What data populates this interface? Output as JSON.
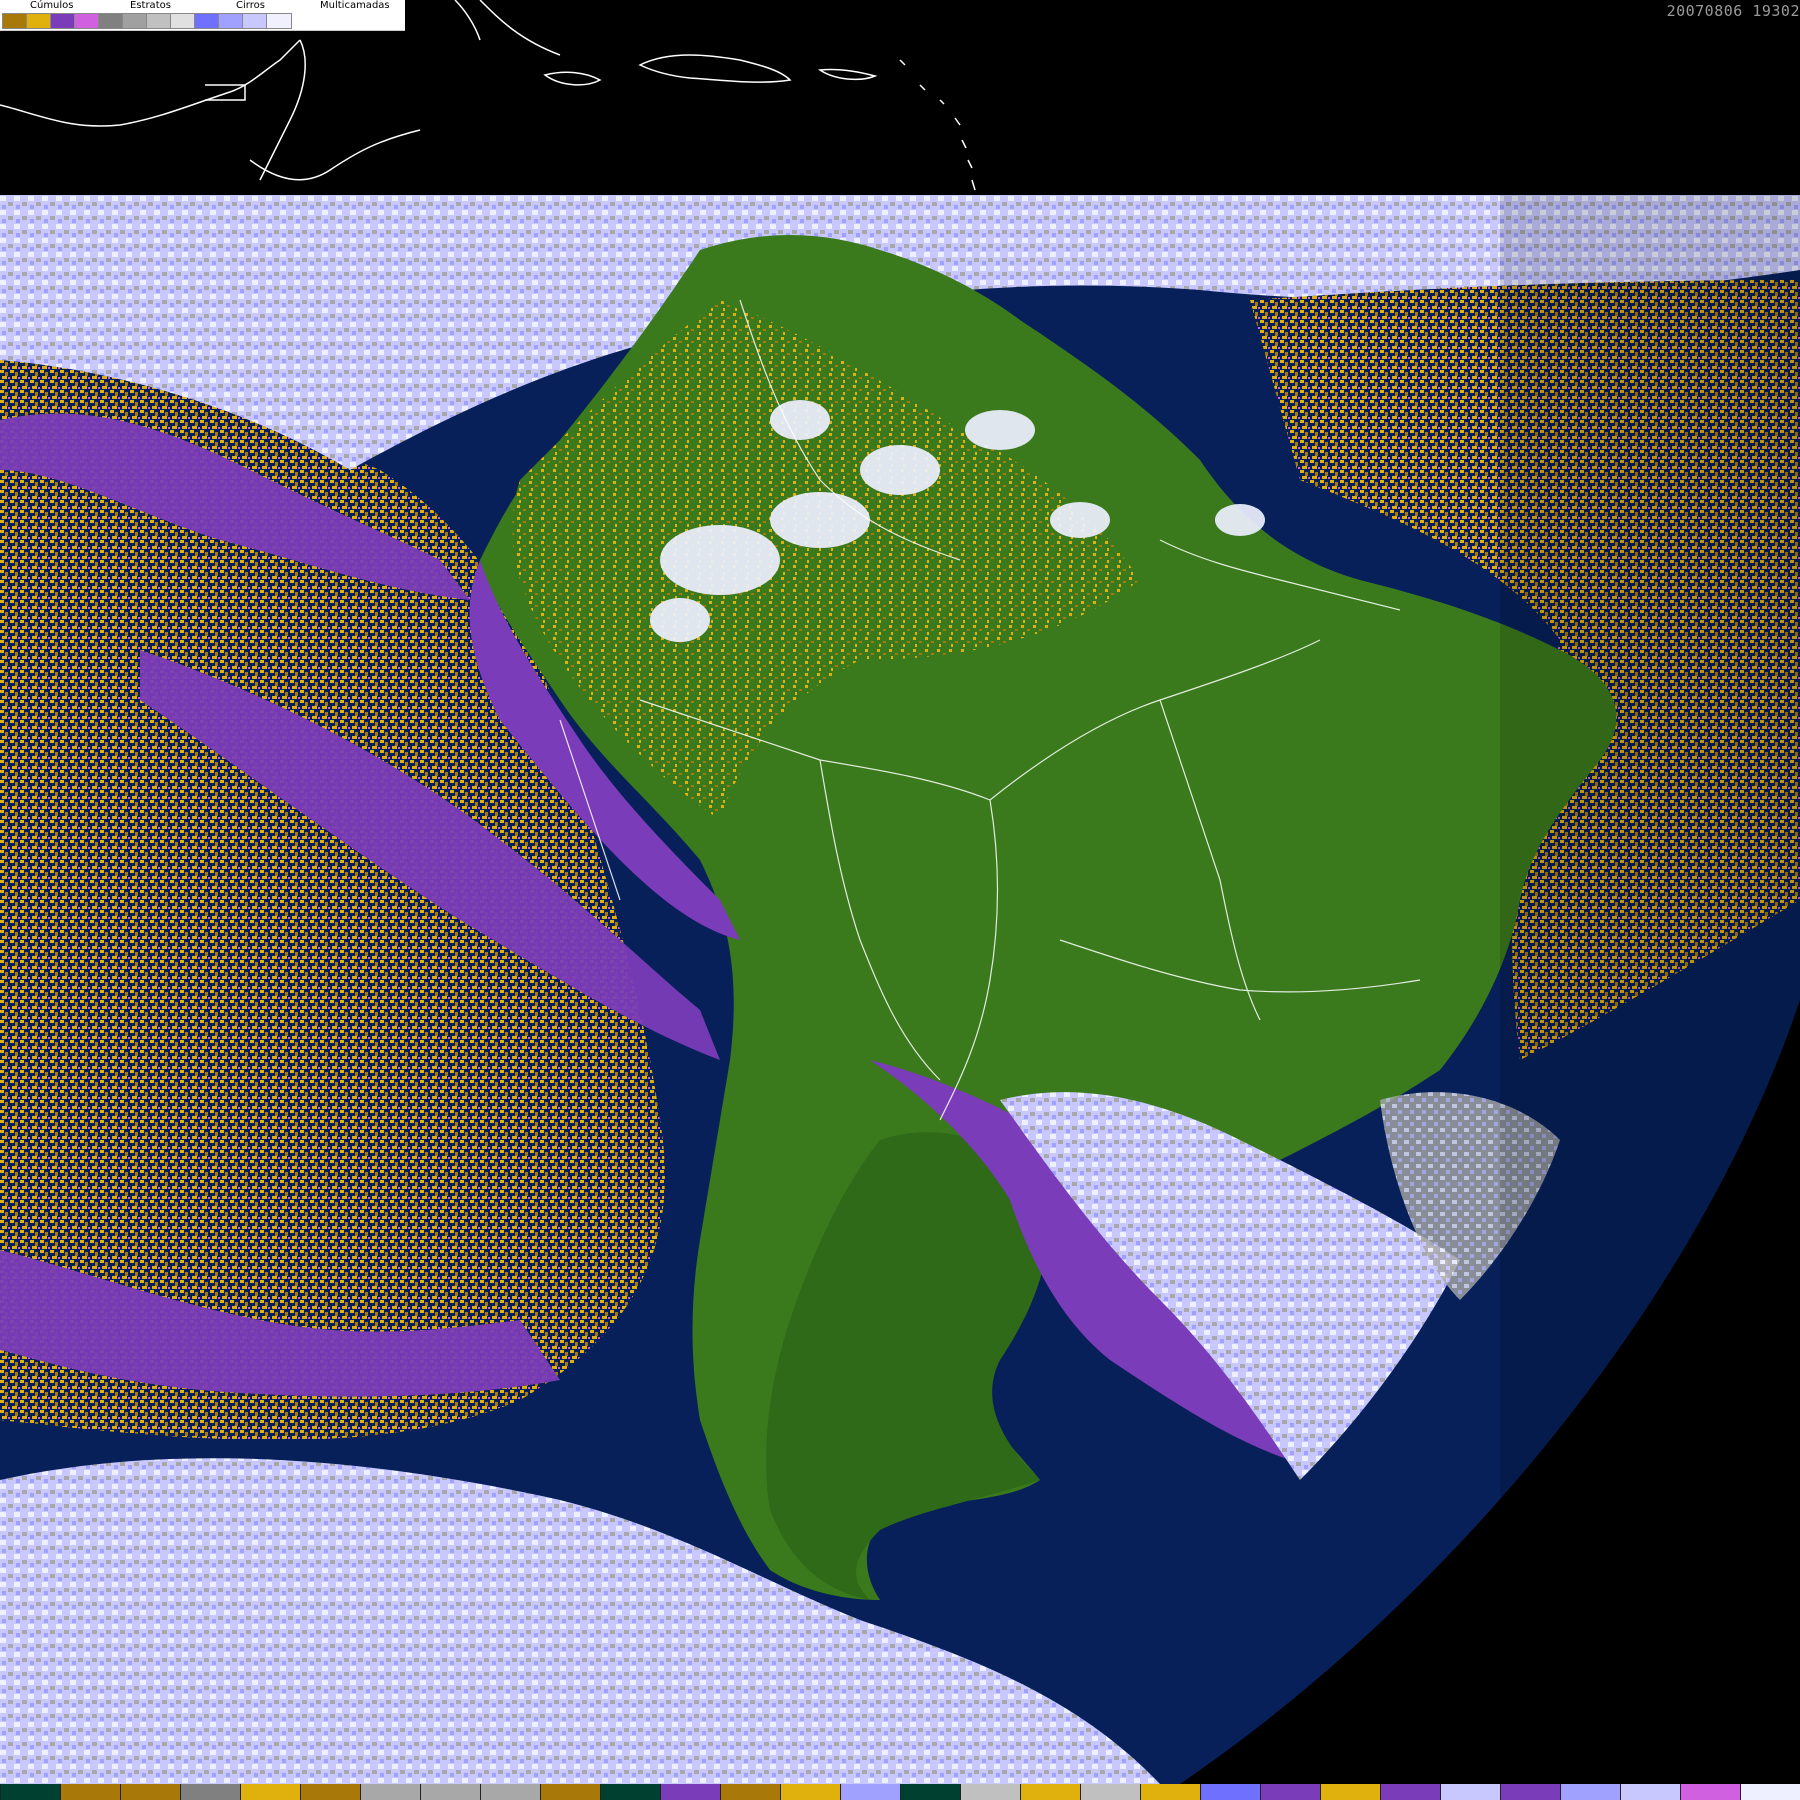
{
  "timestamp": "20070806 19302",
  "legend": {
    "categories": [
      {
        "label": "Cúmulos",
        "colors": [
          "#a87808",
          "#e0b00c"
        ]
      },
      {
        "label": "Estratos",
        "colors": [
          "#7a3cb8",
          "#d060e0"
        ]
      },
      {
        "label": "Cirros",
        "colors": [
          "#808080",
          "#a0a0a0",
          "#c0c0c0",
          "#e0e0e0"
        ]
      },
      {
        "label": "Multicamadas",
        "colors": [
          "#7070ff",
          "#a0a0ff",
          "#c8c8ff",
          "#f0f0ff"
        ]
      }
    ]
  },
  "colors": {
    "space": "#000000",
    "ocean": "#07205a",
    "land": "#3a7a1c",
    "land_dark": "#2a5e14",
    "cumulus_dark": "#a87808",
    "cumulus_light": "#e0b00c",
    "stratus_dark": "#7a3cb8",
    "stratus_light": "#d060e0",
    "cirrus_grey": "#a8a8a8",
    "multi_light": "#c8c8ff",
    "multi_white": "#eef0ff",
    "border_line": "#ffffff"
  },
  "palette_strip": [
    "#004030",
    "#a87808",
    "#a87808",
    "#808080",
    "#e0b00c",
    "#a87808",
    "#a8a8a8",
    "#a8a8a8",
    "#a8a8a8",
    "#a87808",
    "#004030",
    "#7a3cb8",
    "#a87808",
    "#e0b00c",
    "#a0a0ff",
    "#004030",
    "#c0c0c0",
    "#e0b00c",
    "#c0c0c0",
    "#e0b00c",
    "#7070ff",
    "#7a3cb8",
    "#e0b00c",
    "#7a3cb8",
    "#c8c8ff",
    "#7a3cb8",
    "#a0a0ff",
    "#c8c8ff",
    "#d060e0",
    "#eef0ff"
  ]
}
